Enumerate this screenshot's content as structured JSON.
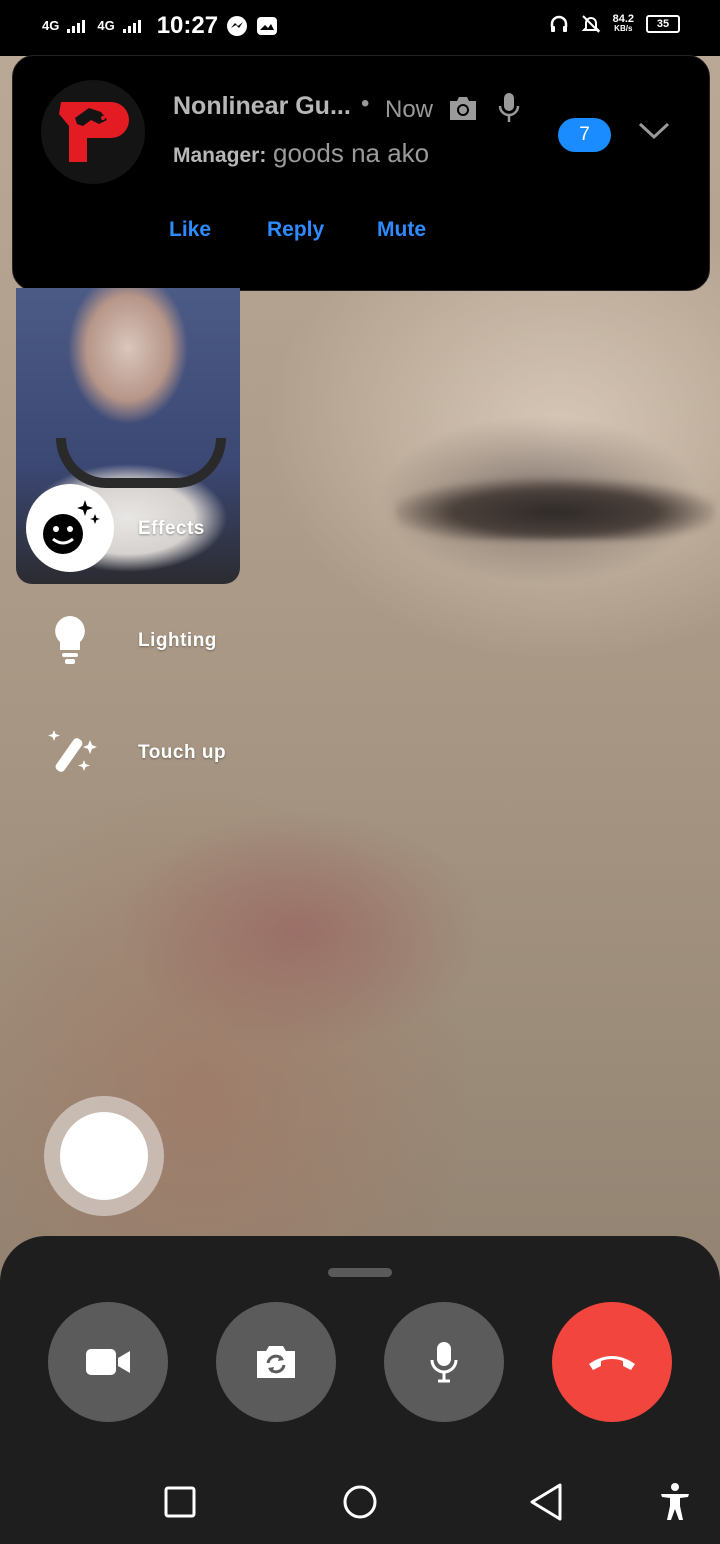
{
  "status_bar": {
    "network_1": "4G",
    "network_2": "4G",
    "time": "10:27",
    "speed_value": "84.2",
    "speed_unit": "KB/s",
    "battery": "35"
  },
  "notification": {
    "title": "Nonlinear Gu...",
    "separator": "•",
    "time": "Now",
    "sender": "Manager:",
    "message": "goods na ako",
    "unread_count": "7",
    "actions": {
      "like": "Like",
      "reply": "Reply",
      "mute": "Mute"
    },
    "accent_color": "#2d8bff",
    "avatar_color": "#e31b23"
  },
  "effects_menu": {
    "effects_label": "Effects",
    "lighting_label": "Lighting",
    "touchup_label": "Touch up"
  },
  "call_controls": {
    "end_call_color": "#f2453d",
    "buttons": [
      "video-toggle",
      "flip-camera",
      "microphone",
      "end-call"
    ]
  },
  "icons": {
    "effects": "smiley-sparkle-icon",
    "lighting": "lightbulb-icon",
    "touchup": "magic-wand-icon"
  }
}
